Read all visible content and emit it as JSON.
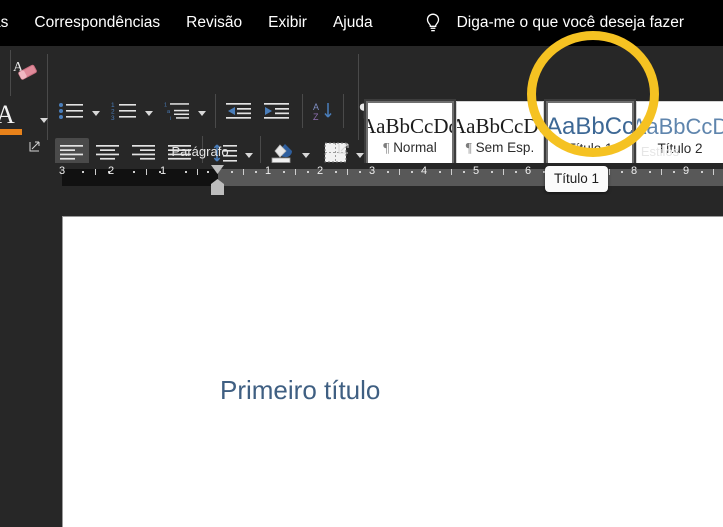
{
  "app": {
    "accent_yellow": "#f5c222",
    "ribbon_bg": "#272727",
    "tabstrip_bg": "#000000",
    "heading_color": "#3f5f82"
  },
  "tabstrip": {
    "tabs": [
      {
        "label": "as"
      },
      {
        "label": "Correspondências"
      },
      {
        "label": "Revisão"
      },
      {
        "label": "Exibir"
      },
      {
        "label": "Ajuda"
      }
    ],
    "tellme": {
      "icon": "lightbulb-icon",
      "label": "Diga-me o que você deseja fazer"
    }
  },
  "ribbon": {
    "font_group": {
      "clear_formatting_icon": "clear-formatting-eraser-icon",
      "font_color_glyph": "A",
      "font_color_swatch": "#e8821a",
      "font_color_dropdown_icon": "chevron-down-icon",
      "launcher_icon": "dialog-launcher-icon"
    },
    "paragraph_group": {
      "label": "Parágrafo",
      "launcher_icon": "dialog-launcher-icon",
      "row1": [
        {
          "name": "bullets-button",
          "icon": "bullet-list-icon"
        },
        {
          "name": "bullets-dropdown",
          "icon": "chevron-down-icon"
        },
        {
          "name": "numbering-button",
          "icon": "numbered-list-icon"
        },
        {
          "name": "numbering-dropdown",
          "icon": "chevron-down-icon"
        },
        {
          "name": "multilevel-list-button",
          "icon": "multilevel-list-icon"
        },
        {
          "name": "multilevel-list-dropdown",
          "icon": "chevron-down-icon"
        },
        {
          "name": "decrease-indent-button",
          "icon": "decrease-indent-icon"
        },
        {
          "name": "increase-indent-button",
          "icon": "increase-indent-icon"
        },
        {
          "name": "sort-button",
          "icon": "sort-az-icon"
        },
        {
          "name": "show-formatting-marks-button",
          "icon": "pilcrow-icon"
        }
      ],
      "row2": [
        {
          "name": "align-left-button",
          "icon": "align-left-icon",
          "active": true
        },
        {
          "name": "align-center-button",
          "icon": "align-center-icon",
          "active": false
        },
        {
          "name": "align-right-button",
          "icon": "align-right-icon",
          "active": false
        },
        {
          "name": "justify-button",
          "icon": "align-justify-icon",
          "active": false
        },
        {
          "name": "line-spacing-button",
          "icon": "line-spacing-icon",
          "active": false
        },
        {
          "name": "line-spacing-dropdown",
          "icon": "chevron-down-icon",
          "active": false
        },
        {
          "name": "shading-button",
          "icon": "shading-paint-bucket-icon",
          "active": false
        },
        {
          "name": "shading-dropdown",
          "icon": "chevron-down-icon",
          "active": false
        },
        {
          "name": "borders-button",
          "icon": "borders-grid-icon",
          "active": false
        },
        {
          "name": "borders-dropdown",
          "icon": "chevron-down-icon",
          "active": false
        }
      ]
    },
    "styles_group": {
      "label": "Estilos",
      "tiles": [
        {
          "sample": "AaBbCcDd",
          "mark": "¶",
          "name": "Normal",
          "variant": "body",
          "selected": true,
          "boxed": true
        },
        {
          "sample": "AaBbCcDd",
          "mark": "¶",
          "name": "Sem Esp.",
          "variant": "body",
          "selected": false,
          "boxed": false
        },
        {
          "sample": "AaBbCc",
          "mark": "",
          "name": "Título 1",
          "variant": "accent",
          "selected": false,
          "boxed": true
        },
        {
          "sample": "AaBbCcD",
          "mark": "",
          "name": "Título 2",
          "variant": "accent2",
          "selected": false,
          "boxed": false
        }
      ],
      "highlight_annotation": {
        "shape": "circle",
        "color": "#f5c222",
        "targets_tile": "Título 1"
      }
    }
  },
  "ruler": {
    "ticks": [
      "3",
      "2",
      "1",
      "1",
      "2",
      "3",
      "4",
      "5",
      "6",
      "7",
      "8",
      "9"
    ],
    "indent_marker_icons": [
      "first-line-indent-marker",
      "hanging-indent-marker",
      "left-indent-marker"
    ]
  },
  "tooltip": {
    "text": "Título 1"
  },
  "document": {
    "heading": "Primeiro título"
  }
}
